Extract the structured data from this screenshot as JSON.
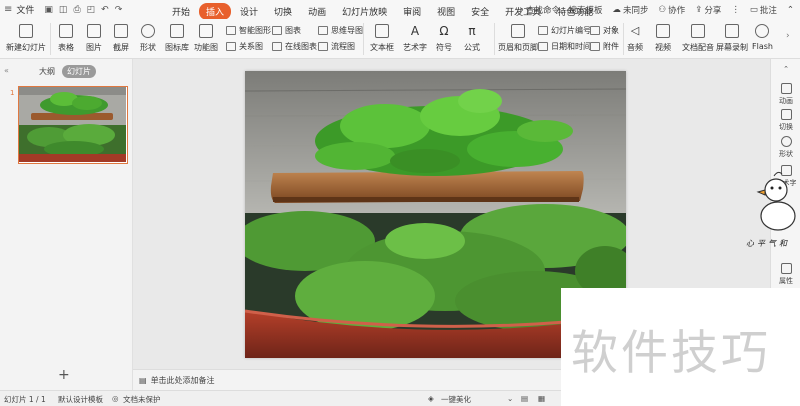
{
  "menubar": {
    "file_label": "文件",
    "tabs": [
      "开始",
      "插入",
      "设计",
      "切换",
      "动画",
      "幻灯片放映",
      "审阅",
      "视图",
      "安全",
      "开发工具",
      "特色功能"
    ],
    "active_tab": "插入",
    "search_label": "查找命令、搜索模板",
    "sync_label": "未同步",
    "collab_label": "协作",
    "share_label": "分享",
    "comment_label": "批注"
  },
  "ribbon": {
    "new_slide": "新建幻灯片",
    "table": "表格",
    "picture": "图片",
    "screenshot": "截屏",
    "shape": "形状",
    "icon_lib": "图标库",
    "func_chart": "功能图",
    "smart_graphic": "智能图形",
    "relation_graph": "关系图",
    "chart": "图表",
    "online_chart": "在线图表",
    "mindmap": "思维导图",
    "flowchart": "流程图",
    "textbox": "文本框",
    "wordart": "艺术字",
    "symbol": "符号",
    "formula": "公式",
    "header_footer": "页眉和页脚",
    "slide_number": "幻灯片编号",
    "datetime": "日期和时间",
    "object": "对象",
    "attachment": "附件",
    "audio": "音频",
    "video": "视频",
    "doc_voice": "文档配音",
    "screen_record": "屏幕录制",
    "flash": "Flash"
  },
  "leftpanel": {
    "outline_tab": "大纲",
    "slides_tab": "幻灯片",
    "slide_number": "1"
  },
  "notes": {
    "placeholder": "单击此处添加备注"
  },
  "rightbar": {
    "items": [
      "动画",
      "切换",
      "形状",
      "艺术字",
      "属性"
    ]
  },
  "sticker_text": "心平气和",
  "statusbar": {
    "slide_info": "幻灯片 1 / 1",
    "template": "默认设计模板",
    "protect": "文档未保护",
    "beautify": "一键美化"
  },
  "watermark": "软件技巧"
}
